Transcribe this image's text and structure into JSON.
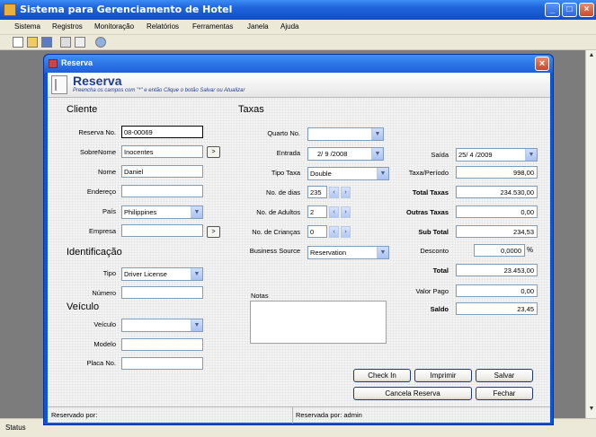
{
  "app": {
    "title": "Sistema para Gerenciamento de Hotel"
  },
  "menu": [
    "Sistema",
    "Registros",
    "Monitoração",
    "Relatórios",
    "Ferramentas",
    "Janela",
    "Ajuda"
  ],
  "status_bar": "Status",
  "dialog": {
    "title": "Reserva",
    "header_title": "Reserva",
    "header_subtitle": "Preencha os campos com \"*\" e então Clique o botão Salvar ou Atualizar",
    "cliente": {
      "section": "Cliente",
      "reserva_no_label": "Reserva No.",
      "reserva_no": "08-00069",
      "sobrenome_label": "SobreNome",
      "sobrenome": "Inocentes",
      "nome_label": "Nome",
      "nome": "Daniel",
      "endereco_label": "Endereço",
      "endereco": "",
      "pais_label": "País",
      "pais": "Philippines",
      "empresa_label": "Empresa",
      "empresa": "",
      "browse_label": ">"
    },
    "identificacao": {
      "section": "Identificação",
      "tipo_label": "Tipo",
      "tipo": "Driver License",
      "numero_label": "Número",
      "numero": ""
    },
    "veiculo": {
      "section": "Veículo",
      "veiculo_label": "Veículo",
      "veiculo": "",
      "modelo_label": "Modelo",
      "modelo": "",
      "placa_label": "Placa No.",
      "placa": ""
    },
    "taxas": {
      "section": "Taxas",
      "quarto_label": "Quarto No.",
      "quarto": "",
      "entrada_label": "Entrada",
      "entrada": "2/ 9 /2008",
      "tipo_taxa_label": "Tipo Taxa",
      "tipo_taxa": "Double",
      "dias_label": "No. de dias",
      "dias": "235",
      "adultos_label": "No. de Adultos",
      "adultos": "2",
      "criancas_label": "No. de Crianças",
      "criancas": "0",
      "business_label": "Business Source",
      "business": "Reservation",
      "notas_label": "Notas"
    },
    "totais": {
      "saida_label": "Saída",
      "saida": "25/ 4 /2009",
      "taxa_periodo_label": "Taxa/Período",
      "taxa_periodo": "998,00",
      "total_taxas_label": "Total Taxas",
      "total_taxas": "234.530,00",
      "outras_taxas_label": "Outras Taxas",
      "outras_taxas": "0,00",
      "sub_total_label": "Sub Total",
      "sub_total": "234,53",
      "desconto_label": "Desconto",
      "desconto": "0,0000",
      "desconto_unit": "%",
      "total_label": "Total",
      "total": "23.453,00",
      "valor_pago_label": "Valor Pago",
      "valor_pago": "0,00",
      "saldo_label": "Saldo",
      "saldo": "23,45"
    },
    "buttons": {
      "check_in": "Check In",
      "imprimir": "Imprimir",
      "salvar": "Salvar",
      "cancela": "Cancela Reserva",
      "fechar": "Fechar"
    },
    "footer": {
      "reservado_por": "Reservado por:",
      "reservada_por": "Reservada por: admin"
    }
  }
}
